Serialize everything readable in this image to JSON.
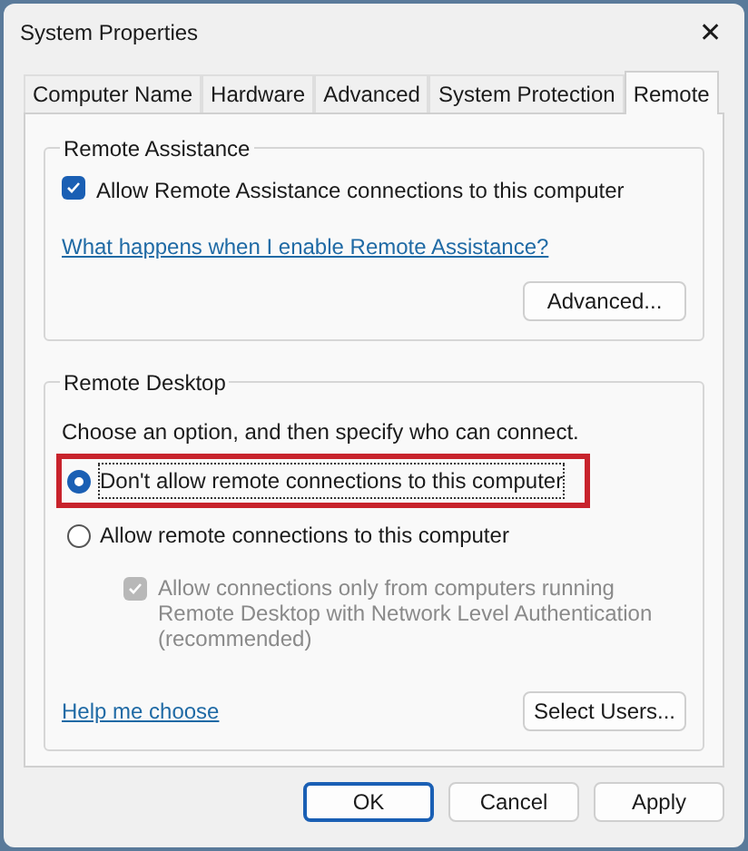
{
  "window": {
    "title": "System Properties",
    "close": "✕"
  },
  "tabs": [
    {
      "label": "Computer Name",
      "selected": false
    },
    {
      "label": "Hardware",
      "selected": false
    },
    {
      "label": "Advanced",
      "selected": false
    },
    {
      "label": "System Protection",
      "selected": false
    },
    {
      "label": "Remote",
      "selected": true
    }
  ],
  "remote_assistance": {
    "title": "Remote Assistance",
    "checkbox": {
      "label": "Allow Remote Assistance connections to this computer",
      "checked": true,
      "disabled": false
    },
    "link": "What happens when I enable Remote Assistance?",
    "button": "Advanced..."
  },
  "remote_desktop": {
    "title": "Remote Desktop",
    "instruction": "Choose an option, and then specify who can connect.",
    "options": [
      {
        "label": "Don't allow remote connections to this computer",
        "selected": true,
        "highlighted": true
      },
      {
        "label": "Allow remote connections to this computer",
        "selected": false,
        "highlighted": false
      }
    ],
    "nla_checkbox": {
      "label": "Allow connections only from computers running Remote Desktop with Network Level Authentication (recommended)",
      "checked": true,
      "disabled": true
    },
    "link": "Help me choose",
    "button": "Select Users..."
  },
  "buttons": [
    {
      "label": "OK",
      "default": true
    },
    {
      "label": "Cancel",
      "default": false
    },
    {
      "label": "Apply",
      "default": false
    }
  ]
}
